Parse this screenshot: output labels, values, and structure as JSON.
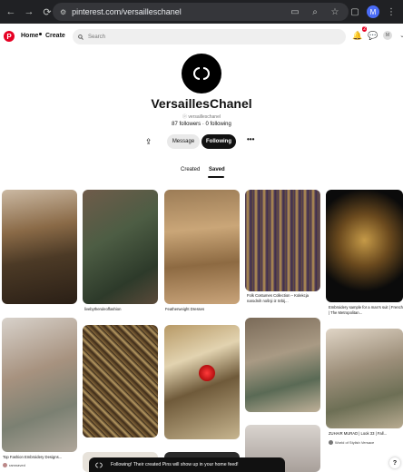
{
  "browser": {
    "url": "pinterest.com/versailleschanel"
  },
  "header": {
    "logo": "P",
    "home_label": "Home",
    "create_label": "Create",
    "search_placeholder": "Search",
    "notification_count": "2",
    "user_initial": "M"
  },
  "profile": {
    "name": "VersaillesChanel",
    "handle": "versailleschanel",
    "follow_stats": "87 followers · 0 following",
    "message_label": "Message",
    "following_label": "Following",
    "more_label": "•••"
  },
  "tabs": {
    "created": "Created",
    "saved": "Saved"
  },
  "pins": [
    {
      "caption": ""
    },
    {
      "caption": "livebytheruleoffashion"
    },
    {
      "caption": "Featherweight Dresses"
    },
    {
      "caption": "Folk Costumes Collection – Kolekcja narodnih nošnji iz Srbij..."
    },
    {
      "caption": "Embroidery sample for a man's suit | French | The Metropolitan..."
    },
    {
      "caption": "Top Fashion Embroidery Designs..."
    },
    {
      "caption": "ZUHAIR MURAD | Look 33 | Fall..."
    },
    {
      "author": "ramnaved"
    },
    {
      "author": "World of Stylish Versace"
    }
  ],
  "toast": {
    "text": "Following! Their created Pins will show up in your home feed!"
  },
  "help_label": "?"
}
